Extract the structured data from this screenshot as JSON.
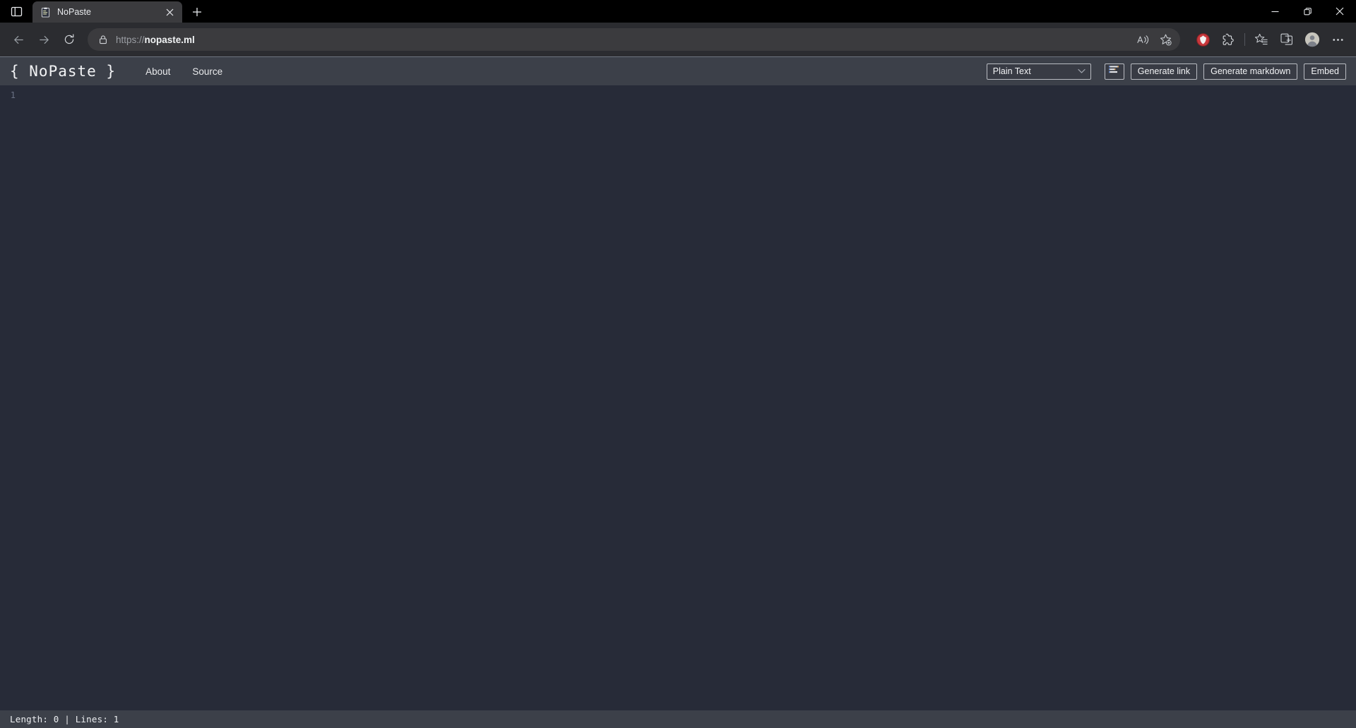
{
  "browser": {
    "tab_search_icon": "vertical-tabs-icon",
    "tab": {
      "favicon": "clipboard-favicon",
      "title": "NoPaste",
      "close_icon": "close-icon"
    },
    "new_tab_icon": "plus-icon",
    "window_controls": {
      "minimize": "minimize-icon",
      "maximize": "maximize-icon",
      "close": "close-icon"
    },
    "nav": {
      "back_icon": "back-arrow-icon",
      "forward_icon": "forward-arrow-icon",
      "reload_icon": "reload-icon"
    },
    "omnibox": {
      "lock_icon": "lock-icon",
      "url_scheme": "https://",
      "url_host": "nopaste.ml",
      "read_aloud_icon": "read-aloud-icon",
      "add_favorite_icon": "add-favorite-star-icon"
    },
    "toolbar": {
      "adblock_icon": "adblock-extension-icon",
      "extensions_icon": "extensions-puzzle-icon",
      "collections_icon": "collections-icon",
      "split_screen_icon": "split-screen-icon",
      "profile_icon": "profile-avatar-icon",
      "settings_icon": "settings-more-icon"
    }
  },
  "app": {
    "logo": "{ NoPaste }",
    "links": [
      {
        "label": "About",
        "name": "nav-link-about"
      },
      {
        "label": "Source",
        "name": "nav-link-source"
      }
    ],
    "language_select": {
      "value": "Plain Text",
      "chevron_icon": "chevron-down-icon"
    },
    "format_button": {
      "icon": "format-lines-icon",
      "title": "Format"
    },
    "buttons": [
      {
        "label": "Generate link",
        "name": "generate-link-button"
      },
      {
        "label": "Generate markdown",
        "name": "generate-markdown-button"
      },
      {
        "label": "Embed",
        "name": "embed-button"
      }
    ],
    "editor": {
      "line_numbers": "1",
      "content": ""
    },
    "status": "Length: 0 | Lines: 1"
  },
  "colors": {
    "chrome_titlebar": "#000000",
    "chrome_toolbar": "#2b2c30",
    "tab_active": "#3b3b3e",
    "app_nav": "#3c4049",
    "editor_bg": "#272b38",
    "accent_text": "#f2f3f5",
    "line_number": "#6a7184",
    "adblock_red": "#c8383c"
  }
}
